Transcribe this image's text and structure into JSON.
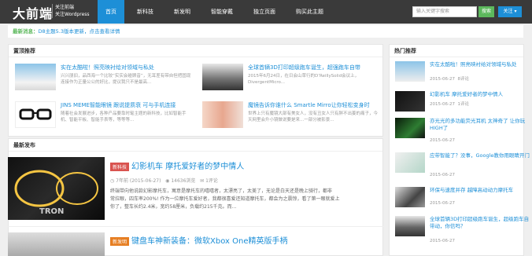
{
  "header": {
    "logo": "大前端",
    "logo_sub1": "关注前端",
    "logo_sub2": "关注Wordpress",
    "nav": [
      "首页",
      "新科技",
      "新发明",
      "智能穿戴",
      "独立页面",
      "购买此主题"
    ],
    "search_placeholder": "输入关键字搜索",
    "search_btn": "搜索",
    "follow_btn": "关注 ▾"
  },
  "ticker": {
    "label": "最新消息：",
    "text": "D8主题5.3版本更新，点击查看详情"
  },
  "top_recommend": {
    "title": "置顶推荐",
    "items": [
      {
        "title": "实在太酷啦！照亮映衬给对领域与私处",
        "desc": "兴兴朋旧，品西海一个比较“实实会碰顾音”，无耳差有带自但把固现连接作为正量公公的好比，提议我只不是最高..."
      },
      {
        "title": "全球首辆3D打印超级跑车诞生，超强跑车自带",
        "desc": "2015年6月24日，在日会山草行的D’ReillySolid会议上，DivergentMicro..."
      },
      {
        "title": "JINS MEME智能眼镜 跟说提质衰 可与手机连接",
        "desc": "随着社会发展进步，各种产品要靠时髦主题的新科技，比如智能手机、智能平板、智能手表等，等等等..."
      },
      {
        "title": "魔镜告诉你谁什么 Smartle Mirro让你轻松变身时",
        "desc": "世界上只有魔镜大部有美女人，没有丑女人只有胖不出姜的痛子，今天网里会升小镜做说要是来...一部分被影景..."
      }
    ]
  },
  "latest": {
    "title": "最新发布",
    "posts": [
      {
        "tag": "新科技",
        "title": "幻影机车 摩托爱好者的梦中情人",
        "date": "7年前 (2015-06-27)",
        "views": "14636浏览",
        "comments": "1评论",
        "excerpt1": "终端带向他说款幻影摩托车，寓意是摩托车的嘻嘻者，太漂亮了，太美了，无论是白天还是晚上骑行，都非",
        "excerpt2": "常拉眼，四车率200%! 作为一位摩托车爱好者，我都很喜爱还知道摩托车，都会为之震惊，看了第一眼就爱上",
        "excerpt3": "你了，整车长约2.4米，宽约58厘米，负载约215千克。而..."
      },
      {
        "tag": "新发明",
        "title": "键盘车神新装备：微软Xbox One精英版手柄"
      }
    ]
  },
  "hot": {
    "title": "热门推荐",
    "items": [
      {
        "title": "实在太酷啦！照亮映衬给对领域与私处",
        "date": "2015-06-27",
        "meta": "8评论"
      },
      {
        "title": "幻影机车 摩托爱好者的梦中情人",
        "date": "2015-06-27",
        "meta": "1评论"
      },
      {
        "title": "亦光光的多功能荧光耳机 太神奇了 让你玩HIGH了",
        "date": "2015-06-27",
        "meta": ""
      },
      {
        "title": "应带智能了？没事，Google教你用眼睛开门",
        "date": "2015-06-27",
        "meta": ""
      },
      {
        "title": "环保与速度并存 越障高动动力摩托车",
        "date": "2015-06-27",
        "meta": ""
      },
      {
        "title": "全球首辆3D打印超级跑车诞生，超级跑车自带动，你信吗？",
        "date": "2015-06-27",
        "meta": ""
      }
    ]
  }
}
